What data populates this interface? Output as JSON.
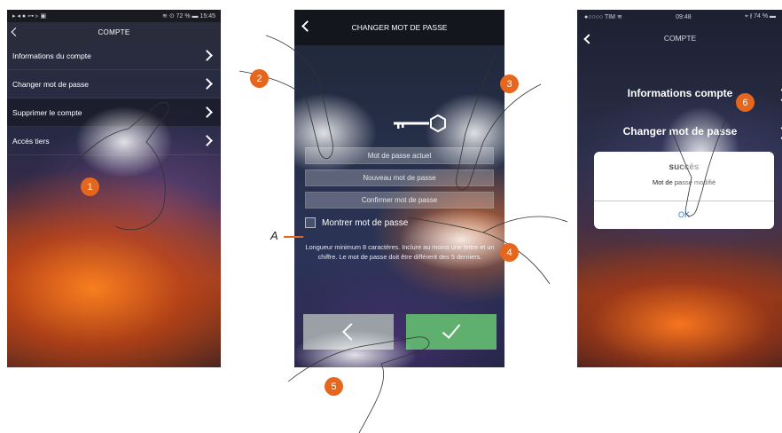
{
  "screen1": {
    "statusbar": {
      "left": "▸ ◂ ● ⊶ ▹ ▣",
      "right": "≋ ⊙ 72 % ▬ 15:45"
    },
    "title": "COMPTE",
    "items": [
      {
        "label": "Informations du compte"
      },
      {
        "label": "Changer mot de passe"
      },
      {
        "label": "Supprimer le compte"
      },
      {
        "label": "Accès tiers"
      }
    ]
  },
  "screen2": {
    "title": "CHANGER MOT DE PASSE",
    "fields": {
      "current": "Mot de passe actuel",
      "new": "Nouveau mot de passe",
      "confirm": "Confirmer mot de passe"
    },
    "show_password": "Montrer mot de passe",
    "hint": "Longueur minimum 8 caractères. Inclure au moins une lettre et un chiffre. Le mot de passe doit être différent des 5 derniers."
  },
  "screen3": {
    "statusbar": {
      "left": "●○○○○ TIM ≋",
      "center": "09:48",
      "right": "⌖ ∦ 74 % ▬"
    },
    "title": "COMPTE",
    "items": [
      {
        "label": "Informations compte"
      },
      {
        "label": "Changer mot de passe"
      }
    ],
    "dialog": {
      "title": "succès",
      "message": "Mot de passe modifié",
      "ok": "OK"
    }
  },
  "annotations": {
    "steps": [
      "1",
      "2",
      "3",
      "4",
      "5",
      "6"
    ],
    "label_a": "A",
    "accent_color": "#e5661d"
  }
}
